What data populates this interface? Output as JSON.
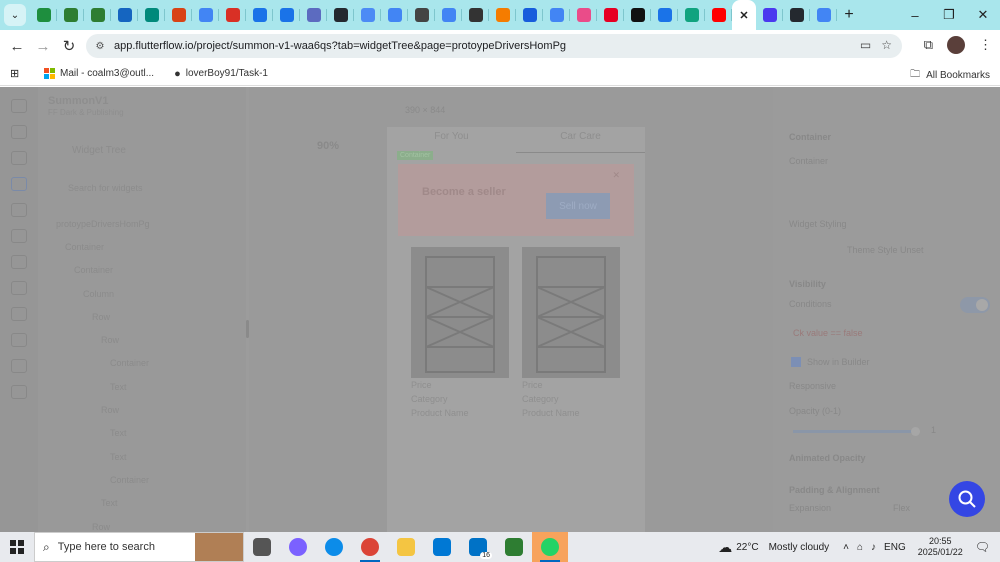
{
  "browser": {
    "url": "app.flutterflow.io/project/summon-v1-waa6qs?tab=widgetTree&page=protoypeDriversHomPg",
    "tabs": [
      {
        "icon": "sheets-icon",
        "color": "#1e8e3e"
      },
      {
        "icon": "android-icon",
        "color": "#2e7d32"
      },
      {
        "icon": "android-icon",
        "color": "#2e7d32"
      },
      {
        "icon": "flutterflow-icon",
        "color": "#1565c0"
      },
      {
        "icon": "refresh-icon",
        "color": "#00897b"
      },
      {
        "icon": "shield-icon",
        "color": "#d84315"
      },
      {
        "icon": "google-icon",
        "color": "#4285f4"
      },
      {
        "icon": "gmail-icon",
        "color": "#d93025"
      },
      {
        "icon": "c-icon",
        "color": "#1a73e8"
      },
      {
        "icon": "c-icon",
        "color": "#1a73e8"
      },
      {
        "icon": "doc-icon",
        "color": "#5c6bc0"
      },
      {
        "icon": "github-icon",
        "color": "#24292f"
      },
      {
        "icon": "gemini-icon",
        "color": "#4c8bf5"
      },
      {
        "icon": "docs-icon",
        "color": "#4285f4"
      },
      {
        "icon": "openai-icon",
        "color": "#444444"
      },
      {
        "icon": "google-icon",
        "color": "#4285f4"
      },
      {
        "icon": "wikipedia-icon",
        "color": "#333333"
      },
      {
        "icon": "firebase-icon",
        "color": "#f57c00"
      },
      {
        "icon": "bitwarden-icon",
        "color": "#175ddc"
      },
      {
        "icon": "google-icon",
        "color": "#4285f4"
      },
      {
        "icon": "dribbble-icon",
        "color": "#ea4c89"
      },
      {
        "icon": "pinterest-icon",
        "color": "#e60023"
      },
      {
        "icon": "link-icon",
        "color": "#111111"
      },
      {
        "icon": "code-icon",
        "color": "#1a73e8"
      },
      {
        "icon": "chatgpt-icon",
        "color": "#10a37f"
      },
      {
        "icon": "youtube-icon",
        "color": "#ff0000"
      },
      {
        "icon": "close-icon",
        "color": "#222222",
        "active": true
      },
      {
        "icon": "flutterflow-icon",
        "color": "#4b39ef"
      },
      {
        "icon": "github-icon",
        "color": "#24292f"
      },
      {
        "icon": "google-icon",
        "color": "#4285f4"
      }
    ],
    "new_tab": "+",
    "bookmarks": [
      {
        "label": "Mail - coalm3@outl...",
        "icon": "microsoft-icon"
      },
      {
        "label": "loverBoy91/Task-1",
        "icon": "github-icon"
      }
    ],
    "all_bookmarks": "All Bookmarks"
  },
  "app": {
    "project_name": "SummonV1",
    "project_sub": "FF Dark & Publishing",
    "widget_tree_title": "Widget Tree",
    "search_placeholder": "Search for widgets",
    "tree": [
      "protoypeDriversHomPg",
      "Container",
      "Container",
      "Column",
      "Row",
      "Row",
      "Container",
      "Text",
      "Row",
      "Text",
      "Text",
      "Container",
      "Text",
      "Row"
    ],
    "device_label": "390 × 844",
    "zoom": "90%",
    "canvas_tabs": [
      "For You",
      "Car Care"
    ],
    "badge": "Container",
    "banner_title": "Become a seller",
    "banner_button": "Sell now",
    "products": [
      {
        "price": "Price",
        "category": "Category",
        "name": "Product Name"
      },
      {
        "price": "Price",
        "category": "Category",
        "name": "Product Name"
      }
    ],
    "right_panel": {
      "header": "Container",
      "sub": "Container",
      "widget_styling": "Widget Styling",
      "theme_style": "Theme Style Unset",
      "visibility": "Visibility",
      "conditions": "Conditions",
      "condition_expr": "Ck value == false",
      "responsive": "Responsive",
      "opacity": "Opacity (0-1)",
      "opacity_value": "1",
      "animated_opacity": "Animated Opacity",
      "padding": "Padding & Alignment",
      "padding_sub": "Expansion",
      "padding_sub2": "Flex",
      "show_label": "Show in Builder"
    }
  },
  "taskbar": {
    "search_placeholder": "Type here to search",
    "icons": [
      {
        "name": "task-view-icon",
        "color": "#555555"
      },
      {
        "name": "copilot-icon",
        "color": "#7b61ff"
      },
      {
        "name": "edge-icon",
        "color": "#0c8ce9"
      },
      {
        "name": "chrome-icon",
        "color": "#db4437"
      },
      {
        "name": "file-explorer-icon",
        "color": "#f4c542"
      },
      {
        "name": "store-icon",
        "color": "#0078d4"
      },
      {
        "name": "mail-icon",
        "color": "#0072c6"
      },
      {
        "name": "maps-icon",
        "color": "#2e7d32"
      },
      {
        "name": "whatsapp-icon",
        "color": "#25d366"
      }
    ],
    "mail_badge": "16",
    "weather_temp": "22°C",
    "weather_text": "Mostly cloudy",
    "weather_alert": "1",
    "language": "ENG",
    "time": "20:55",
    "date": "2025/01/22",
    "notification_count": "2"
  }
}
